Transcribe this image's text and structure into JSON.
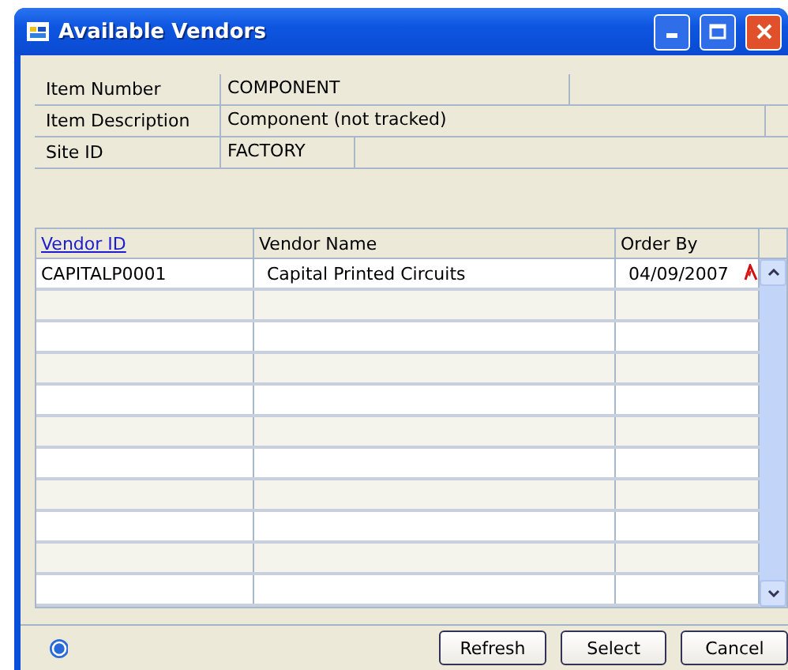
{
  "window": {
    "title": "Available Vendors"
  },
  "item_fields": [
    {
      "label": "Item Number",
      "value": "COMPONENT",
      "kind": "medium"
    },
    {
      "label": "Item Description",
      "value": "Component (not tracked)",
      "kind": "wide"
    },
    {
      "label": "Site ID",
      "value": "FACTORY",
      "kind": "short"
    }
  ],
  "table": {
    "columns": [
      {
        "label": "Vendor ID",
        "link": true
      },
      {
        "label": "Vendor Name",
        "link": false
      },
      {
        "label": "Order By",
        "link": false
      }
    ],
    "rows": [
      {
        "cells": [
          "CAPITALP0001",
          "Capital Printed Circuits",
          "04/09/2007"
        ]
      }
    ]
  },
  "buttons": [
    "Refresh",
    "Select",
    "Cancel"
  ]
}
